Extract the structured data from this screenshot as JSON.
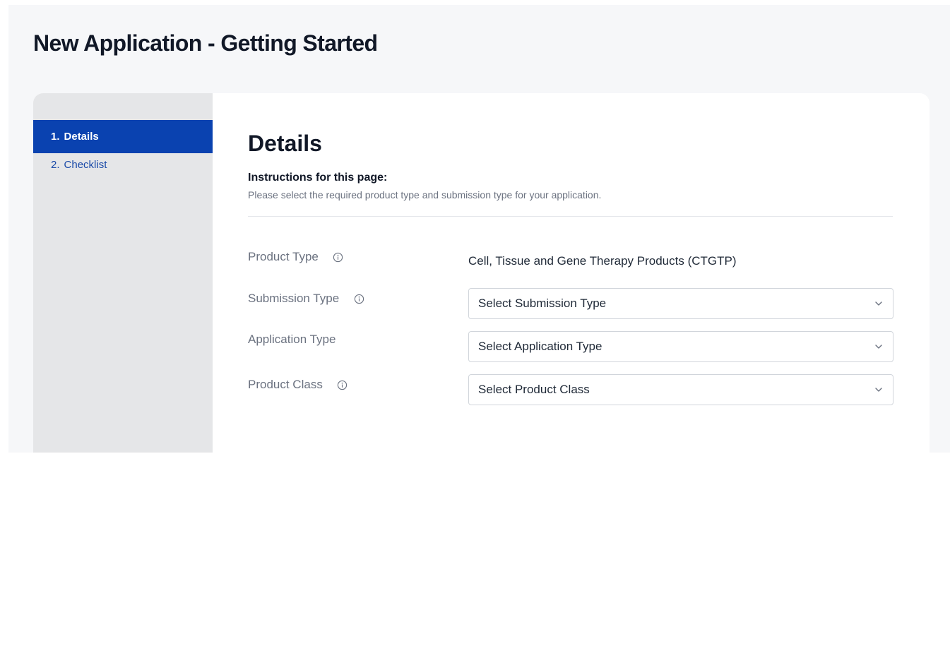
{
  "page": {
    "title": "New Application - Getting Started"
  },
  "steps": [
    {
      "number": "1.",
      "label": "Details",
      "active": true
    },
    {
      "number": "2.",
      "label": "Checklist",
      "active": false
    }
  ],
  "details": {
    "title": "Details",
    "instructions_heading": "Instructions for this page:",
    "instructions_text": "Please select the required product type and submission type for your application.",
    "fields": {
      "product_type": {
        "label": "Product Type",
        "value": "Cell, Tissue and Gene Therapy Products (CTGTP)",
        "icon": "info-icon"
      },
      "submission_type": {
        "label": "Submission Type",
        "placeholder": "Select Submission Type",
        "icon": "info-icon"
      },
      "application_type": {
        "label": "Application Type",
        "placeholder": "Select Application Type"
      },
      "product_class": {
        "label": "Product Class",
        "placeholder": "Select Product Class",
        "icon": "info-icon"
      }
    }
  },
  "colors": {
    "accent": "#0a42b0",
    "link": "#1a4aa8",
    "sidebar_bg": "#e5e6e8",
    "page_bg": "#f6f7f9"
  }
}
